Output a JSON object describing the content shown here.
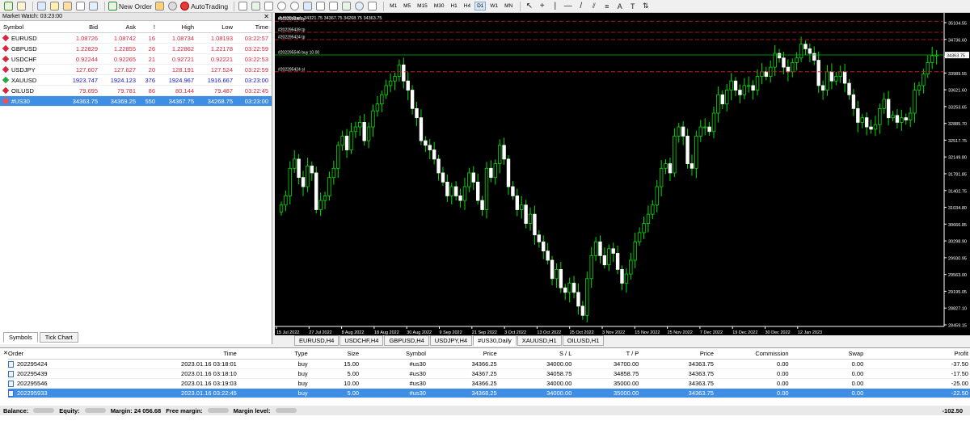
{
  "toolbar": {
    "new_order": "New Order",
    "auto_trading": "AutoTrading",
    "timeframes": [
      "M1",
      "M5",
      "M15",
      "M30",
      "H1",
      "H4",
      "D1",
      "W1",
      "MN"
    ],
    "active_timeframe": "D1"
  },
  "market_watch": {
    "title": "Market Watch: 03:23:00",
    "headers": {
      "symbol": "Symbol",
      "bid": "Bid",
      "ask": "Ask",
      "spread": "!",
      "high": "High",
      "low": "Low",
      "time": "Time"
    },
    "rows": [
      {
        "symbol": "EURUSD",
        "bid": "1.08726",
        "ask": "1.08742",
        "spread": "16",
        "high": "1.08734",
        "low": "1.08193",
        "time": "03:22:57",
        "color": "red",
        "icon_color": "#d7263d"
      },
      {
        "symbol": "GBPUSD",
        "bid": "1.22829",
        "ask": "1.22855",
        "spread": "26",
        "high": "1.22862",
        "low": "1.22178",
        "time": "03:22:59",
        "color": "red",
        "icon_color": "#d7263d"
      },
      {
        "symbol": "USDCHF",
        "bid": "0.92244",
        "ask": "0.92265",
        "spread": "21",
        "high": "0.92721",
        "low": "0.92221",
        "time": "03:22:53",
        "color": "red",
        "icon_color": "#d7263d"
      },
      {
        "symbol": "USDJPY",
        "bid": "127.607",
        "ask": "127.627",
        "spread": "20",
        "high": "128.191",
        "low": "127.524",
        "time": "03:22:59",
        "color": "red",
        "icon_color": "#d7263d"
      },
      {
        "symbol": "XAUUSD",
        "bid": "1923.747",
        "ask": "1924.123",
        "spread": "376",
        "high": "1924.967",
        "low": "1916.667",
        "time": "03:23:00",
        "color": "blue",
        "icon_color": "#28a745"
      },
      {
        "symbol": "OILUSD",
        "bid": "79.695",
        "ask": "79.781",
        "spread": "86",
        "high": "80.144",
        "low": "79.487",
        "time": "03:22:45",
        "color": "red",
        "icon_color": "#d7263d"
      },
      {
        "symbol": "#US30",
        "bid": "34363.75",
        "ask": "34369.25",
        "spread": "550",
        "high": "34367.75",
        "low": "34268.75",
        "time": "03:23:00",
        "color": "blue",
        "icon_color": "#ff4a4a",
        "selected": true
      }
    ],
    "tabs": [
      "Symbols",
      "Tick Chart"
    ]
  },
  "chart": {
    "header": "#US30,Daily  34321.75 34367.75 34268.75 34363.75",
    "order_labels": [
      {
        "text": "#202295938 tp",
        "price": 35100
      },
      {
        "text": "#202295439 tp",
        "price": 34858.75
      },
      {
        "text": "#202295424 tp",
        "price": 34700
      },
      {
        "text": "#202295546 buy 10.00",
        "price": 34366.25
      },
      {
        "text": "#202295424 sl",
        "price": 34000
      }
    ],
    "price_ticks": [
      "35104.55",
      "34736.60",
      "34363.75",
      "33989.55",
      "33621.60",
      "33253.65",
      "32885.70",
      "32517.75",
      "32149.80",
      "31781.85",
      "31402.75",
      "31034.80",
      "30666.85",
      "30298.90",
      "29930.95",
      "29563.00",
      "29195.05",
      "28827.10",
      "28459.15"
    ],
    "current_price": "34363.75",
    "date_ticks": [
      "15 Jul 2022",
      "27 Jul 2022",
      "8 Aug 2022",
      "18 Aug 2022",
      "30 Aug 2022",
      "9 Sep 2022",
      "21 Sep 2022",
      "3 Oct 2022",
      "13 Oct 2022",
      "25 Oct 2022",
      "3 Nov 2022",
      "15 Nov 2022",
      "25 Nov 2022",
      "7 Dec 2022",
      "19 Dec 2022",
      "30 Dec 2022",
      "12 Jan 2023"
    ],
    "tabs": [
      "EURUSD,H4",
      "USDCHF,H4",
      "GBPUSD,H4",
      "USDJPY,H4",
      "#US30,Daily",
      "XAUUSD,H1",
      "OILUSD,H1"
    ],
    "active_tab": "#US30,Daily"
  },
  "chart_data": {
    "type": "candlestick",
    "y_range": [
      28459.15,
      35104.55
    ],
    "closes": [
      31100,
      31300,
      31900,
      32100,
      31700,
      31500,
      31950,
      31800,
      31000,
      31200,
      31300,
      31700,
      31900,
      32400,
      32600,
      32300,
      32700,
      32800,
      32900,
      32500,
      32800,
      33150,
      33300,
      33500,
      33700,
      33800,
      33900,
      34150,
      33800,
      33600,
      33200,
      33000,
      32500,
      32400,
      32300,
      32100,
      31800,
      31600,
      31300,
      31500,
      31300,
      31200,
      31500,
      31800,
      31600,
      31200,
      31000,
      31900,
      31700,
      32000,
      32400,
      32100,
      31500,
      31300,
      31000,
      31100,
      30700,
      30900,
      30450,
      30300,
      30100,
      29900,
      29500,
      29700,
      29300,
      29200,
      29400,
      29200,
      28900,
      28700,
      29500,
      30000,
      30300,
      30000,
      29800,
      30150,
      30050,
      29700,
      29400,
      29600,
      29900,
      30300,
      30500,
      30700,
      30900,
      31100,
      31500,
      31900,
      32000,
      31800,
      32600,
      32800,
      32600,
      32000,
      31900,
      32600,
      32800,
      32800,
      32700,
      33100,
      33500,
      33300,
      33600,
      33800,
      33600,
      33500,
      33700,
      33700,
      33600,
      33900,
      34000,
      33900,
      34100,
      34400,
      34300,
      34100,
      34000,
      34200,
      34300,
      34600,
      34500,
      34400,
      34250,
      33700,
      33600,
      34000,
      33800,
      33900,
      34000,
      33750,
      33500,
      33200,
      32900,
      33000,
      32800,
      32750,
      32850,
      33200,
      33400,
      33000,
      33050,
      32900,
      33000,
      32950,
      33100,
      33600,
      33700,
      33950,
      34200,
      34350,
      34364
    ],
    "current_price": 34363.75
  },
  "orders": {
    "headers": {
      "order": "Order",
      "time": "Time",
      "type": "Type",
      "size": "Size",
      "symbol": "Symbol",
      "price": "Price",
      "sl": "S / L",
      "tp": "T / P",
      "cur_price": "Price",
      "commission": "Commission",
      "swap": "Swap",
      "profit": "Profit"
    },
    "rows": [
      {
        "order": "202295424",
        "time": "2023.01.16 03:18:01",
        "type": "buy",
        "size": "15.00",
        "symbol": "#us30",
        "price": "34366.25",
        "sl": "34000.00",
        "tp": "34700.00",
        "cur_price": "34363.75",
        "commission": "0.00",
        "swap": "0.00",
        "profit": "-37.50"
      },
      {
        "order": "202295439",
        "time": "2023.01.16 03:18:10",
        "type": "buy",
        "size": "5.00",
        "symbol": "#us30",
        "price": "34367.25",
        "sl": "34058.75",
        "tp": "34858.75",
        "cur_price": "34363.75",
        "commission": "0.00",
        "swap": "0.00",
        "profit": "-17.50"
      },
      {
        "order": "202295546",
        "time": "2023.01.16 03:19:03",
        "type": "buy",
        "size": "10.00",
        "symbol": "#us30",
        "price": "34366.25",
        "sl": "34000.00",
        "tp": "35000.00",
        "cur_price": "34363.75",
        "commission": "0.00",
        "swap": "0.00",
        "profit": "-25.00"
      },
      {
        "order": "202295933",
        "time": "2023.01.16 03:22:45",
        "type": "buy",
        "size": "5.00",
        "symbol": "#us30",
        "price": "34368.25",
        "sl": "34000.00",
        "tp": "35000.00",
        "cur_price": "34363.75",
        "commission": "0.00",
        "swap": "0.00",
        "profit": "-22.50",
        "selected": true
      }
    ],
    "balance_label": "Balance:",
    "equity_label": "Equity:",
    "margin_label": "Margin: 24 056.68",
    "free_margin_label": "Free margin:",
    "margin_level_label": "Margin level:",
    "total_profit": "-102.50"
  }
}
